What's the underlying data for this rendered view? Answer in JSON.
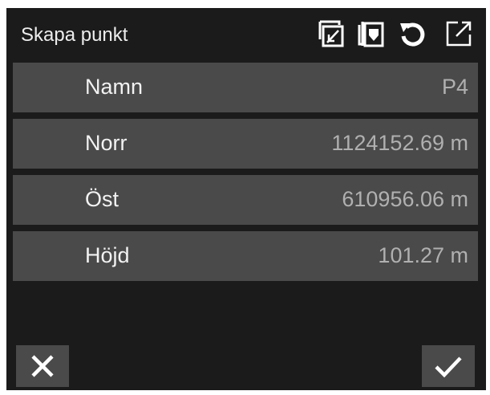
{
  "dialog": {
    "title": "Skapa punkt"
  },
  "header_icons": [
    {
      "name": "measure-point-icon"
    },
    {
      "name": "copy-point-icon"
    },
    {
      "name": "reset-icon"
    },
    {
      "name": "expand-icon"
    }
  ],
  "fields": [
    {
      "label": "Namn",
      "value": "P4"
    },
    {
      "label": "Norr",
      "value": "1124152.69 m"
    },
    {
      "label": "Öst",
      "value": "610956.06 m"
    },
    {
      "label": "Höjd",
      "value": "101.27 m"
    }
  ],
  "actions": {
    "cancel_icon": "close-icon",
    "confirm_icon": "check-icon"
  },
  "colors": {
    "panel_background": "#1b1b1b",
    "row_background": "#4a4a4a",
    "label_text": "#f2f2f2",
    "value_text": "#b0b0b0",
    "icon": "#ffffff"
  }
}
